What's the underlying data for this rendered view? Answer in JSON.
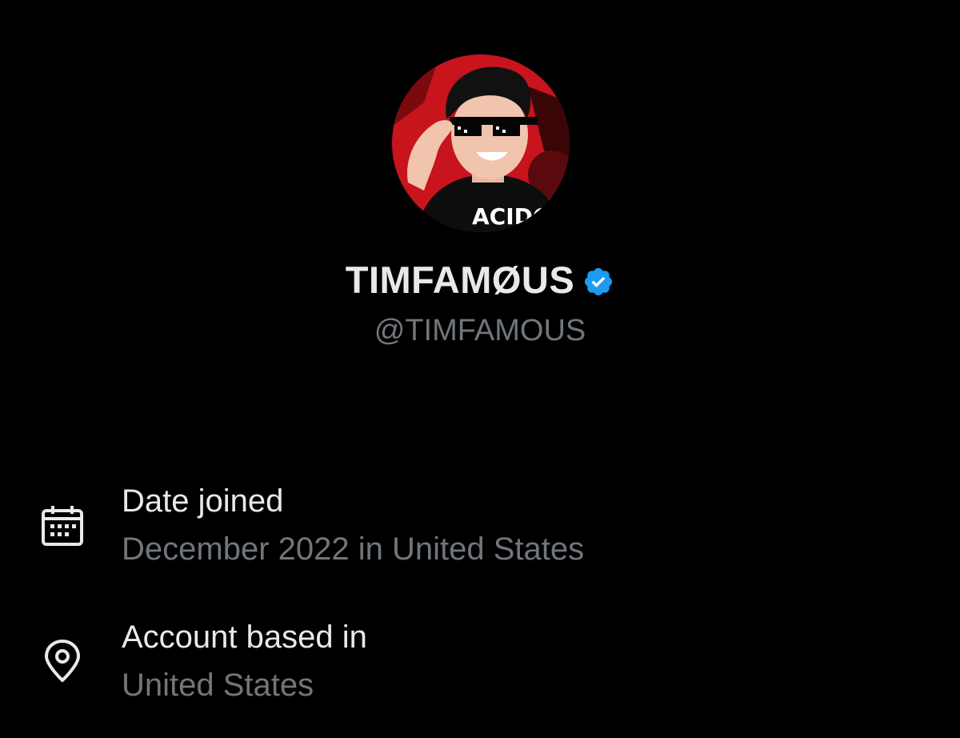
{
  "profile": {
    "display_name": "TIMFAMØUS",
    "handle": "@TIMFAMOUS",
    "verified": true,
    "avatar_shirt_text": "ACIDC"
  },
  "about": {
    "items": [
      {
        "icon": "calendar-icon",
        "label": "Date joined",
        "value": "December 2022 in United States"
      },
      {
        "icon": "location-pin-icon",
        "label": "Account based in",
        "value": "United States"
      }
    ]
  },
  "colors": {
    "background": "#000000",
    "primary_text": "#e7e9ea",
    "secondary_text": "#71767b",
    "verified_badge": "#1d9bf0",
    "avatar_red": "#c8141c"
  }
}
